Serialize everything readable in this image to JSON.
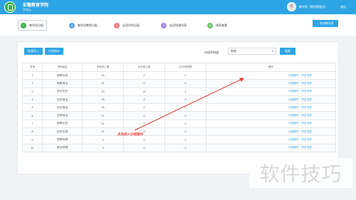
{
  "header": {
    "title": "安徽教育学院",
    "subtitle": "学校云",
    "user_name": "教学院（教师管理员）",
    "logout_label": "退出"
  },
  "steps": [
    {
      "num": "1",
      "label": "教学班分配",
      "color": "#38b24a",
      "active": true
    },
    {
      "num": "2",
      "label": "教学班教师分配",
      "color": "#5aa9e6",
      "active": false
    },
    {
      "num": "3",
      "label": "走班学科分配",
      "color": "#f07a8a",
      "active": false
    },
    {
      "num": "4",
      "label": "走班排课列表",
      "color": "#a68be0",
      "active": false
    },
    {
      "num": "5",
      "label": "课表查看",
      "color": "#6cc86e",
      "active": false
    }
  ],
  "toolbar": {
    "add_label": "+ 添加教学班",
    "btn_import": "批量导入",
    "btn_export": "分班统计",
    "filter_label": "分班学科组：",
    "filter_value": "物理",
    "filter_chevron": "▾",
    "search_label": "搜索"
  },
  "table": {
    "headers": [
      "序号",
      "学科组合",
      "本班总人数",
      "已分班人数",
      "已分班班数",
      "操作"
    ],
    "rows": [
      [
        "1",
        "物理/化学",
        "46",
        "0",
        "0"
      ],
      [
        "2",
        "物理/政治",
        "24",
        "0",
        "0"
      ],
      [
        "3",
        "历史/历史",
        "20",
        "18",
        "2"
      ],
      [
        "4",
        "历史/政治",
        "28",
        "0",
        "0"
      ],
      [
        "5",
        "历史/政治",
        "38",
        "0",
        "0"
      ],
      [
        "6",
        "生物/政治",
        "31",
        "0",
        "0"
      ],
      [
        "7",
        "物理/化学",
        "24",
        "0",
        "0"
      ],
      [
        "8",
        "历史/生物",
        "24",
        "0",
        "0"
      ],
      [
        "9",
        "物理/地理",
        "9",
        "0",
        "0"
      ],
      [
        "10",
        "政治/地理",
        "9",
        "0",
        "0"
      ]
    ],
    "op_links": [
      "分班操作",
      "学生列表"
    ]
  },
  "annotation": "点击进入分班操作",
  "watermark": "软件技巧"
}
